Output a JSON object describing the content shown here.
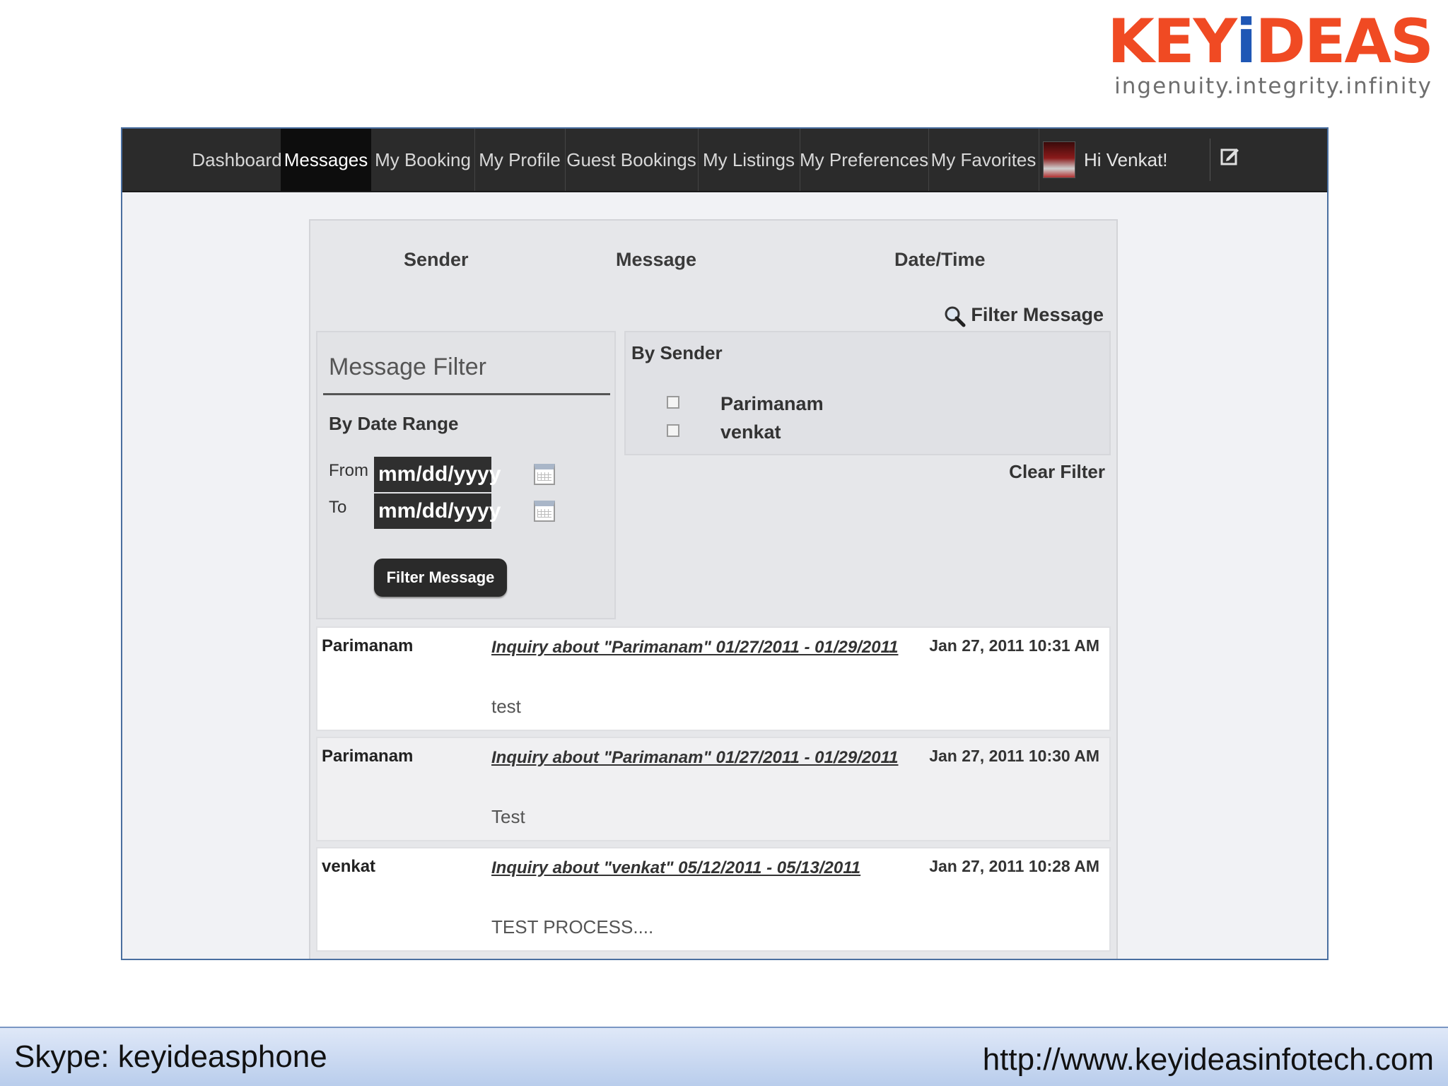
{
  "brand": {
    "logo_main": "KEY",
    "logo_i": "i",
    "logo_end": "DEAS",
    "tagline": "ingenuity.integrity.infinity",
    "colors": {
      "orange": "#f04a23",
      "blue": "#1f57b5"
    }
  },
  "nav": {
    "items": [
      {
        "label": "Dashboard"
      },
      {
        "label": "Messages",
        "active": true
      },
      {
        "label": "My Booking"
      },
      {
        "label": "My Profile"
      },
      {
        "label": "Guest Bookings"
      },
      {
        "label": "My Listings"
      },
      {
        "label": "My Preferences"
      },
      {
        "label": "My Favorites"
      }
    ],
    "greeting": "Hi Venkat!",
    "avatar_icon": "user-avatar",
    "edit_icon": "edit-icon"
  },
  "columns": {
    "sender": "Sender",
    "message": "Message",
    "datetime": "Date/Time"
  },
  "filter_link": "Filter Message",
  "message_filter": {
    "title": "Message Filter",
    "by_date_range": "By Date Range",
    "from_label": "From",
    "to_label": "To",
    "from_value": "mm/dd/yyyy",
    "to_value": "mm/dd/yyyy",
    "button": "Filter Message"
  },
  "by_sender": {
    "title": "By Sender",
    "senders": [
      "Parimanam",
      "venkat"
    ],
    "clear": "Clear Filter"
  },
  "messages": [
    {
      "sender": "Parimanam",
      "subject": "Inquiry about \"Parimanam\" 01/27/2011 - 01/29/2011",
      "date": "Jan 27, 2011 10:31 AM",
      "body": "test"
    },
    {
      "sender": "Parimanam",
      "subject": "Inquiry about \"Parimanam\" 01/27/2011 - 01/29/2011",
      "date": "Jan 27, 2011 10:30 AM",
      "body": "Test"
    },
    {
      "sender": "venkat",
      "subject": "Inquiry about \"venkat\" 05/12/2011 - 05/13/2011",
      "date": "Jan 27, 2011 10:28 AM",
      "body": "TEST PROCESS...."
    }
  ],
  "footer": {
    "skype": "Skype: keyideasphone",
    "url": "http://www.keyideasinfotech.com"
  }
}
